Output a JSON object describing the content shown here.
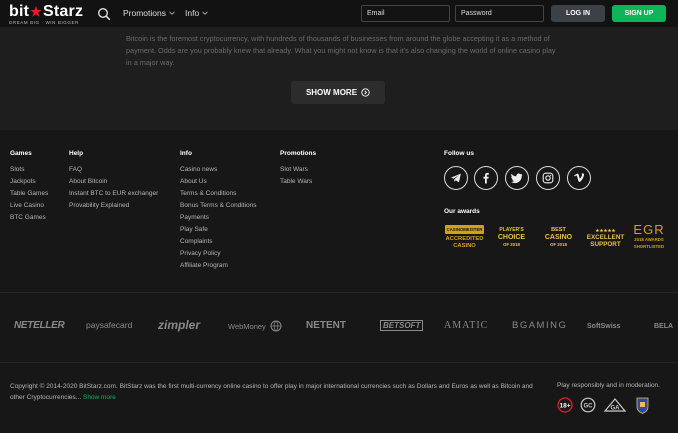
{
  "header": {
    "logo_text_left": "bit",
    "logo_star": "★",
    "logo_text_right": "Starz",
    "logo_tagline": "DREAM BIG · WIN BIGGER",
    "nav": [
      {
        "label": "Promotions"
      },
      {
        "label": "Info"
      }
    ],
    "email_placeholder": "Email",
    "password_placeholder": "Password",
    "login_label": "LOG IN",
    "signup_label": "SIGN UP"
  },
  "article": {
    "text": "Bitcoin is the foremost cryptocurrency, with hundreds of thousands of businesses from around the globe accepting it as a method of payment. Odds are you probably knew that already. What you might not know is that it's also changing the world of online casino play in a major way.",
    "show_more_label": "SHOW MORE"
  },
  "footer": {
    "columns": [
      {
        "title": "Games",
        "links": [
          "Slots",
          "Jackpots",
          "Table Games",
          "Live Casino",
          "BTC Games"
        ]
      },
      {
        "title": "Help",
        "links": [
          "FAQ",
          "About Bitcoin",
          "Instant BTC to EUR exchanger",
          "Provability Explained"
        ]
      },
      {
        "title": "Info",
        "links": [
          "Casino news",
          "About Us",
          "Terms & Conditions",
          "Bonus Terms & Conditions",
          "Payments",
          "Play Safe",
          "Complaints",
          "Privacy Policy",
          "Affiliate Program"
        ]
      },
      {
        "title": "Promotions",
        "links": [
          "Slot Wars",
          "Table Wars"
        ]
      }
    ],
    "follow_title": "Follow us",
    "social": [
      "telegram-icon",
      "facebook-icon",
      "twitter-icon",
      "instagram-icon",
      "vimeo-icon"
    ],
    "awards_title": "Our awards",
    "awards": [
      {
        "line1": "CASINOMEISTER",
        "line2": "ACCREDITED",
        "line3": "CASINO"
      },
      {
        "line1": "PLAYER'S",
        "line2": "CHOICE",
        "line3": "OF 2018"
      },
      {
        "line1": "BEST",
        "line2": "CASINO",
        "line3": "OF 2018"
      },
      {
        "line1": "EXCELLENT",
        "line2": "SUPPORT",
        "line3": "★★★★★"
      },
      {
        "line1": "EGR",
        "line2": "2018 AWARDS",
        "line3": "SHORTLISTED"
      }
    ],
    "payments": [
      "NETELLER",
      "paysafecard",
      "zimpler",
      "WebMoney",
      "NETENT",
      "BETSOFT",
      "AMATIC",
      "BGAMING",
      "SoftSwiss",
      "BELA"
    ],
    "copyright": "Copyright © 2014-2020 BitStarz.com. BitStarz was the first multi-currency online casino to offer play in major international currencies such as Dollars and Euros as well as Bitcoin and other Cryptocurrencies...",
    "copyright_link": "Show more",
    "responsible": "Play responsibly and in moderation.",
    "badges": [
      "18+",
      "GC",
      "GA",
      "Curaçao"
    ]
  },
  "colors": {
    "accent_green": "#0fb35a",
    "logo_red": "#e21f26",
    "award_gold": "#d4a017"
  }
}
